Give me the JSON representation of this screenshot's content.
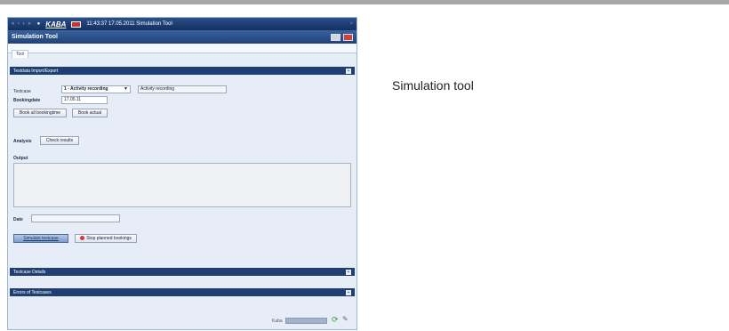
{
  "caption": "Simulation tool",
  "app": {
    "titlebar": {
      "nav": "« ‹ › »",
      "dot": "●",
      "logo": "KABA",
      "info": "11:43:37  17.05.2011  Simulation Tool",
      "close": "×"
    },
    "header_title": "Simulation Tool",
    "tab": "Tool",
    "panels": {
      "testdata": "Testdata Import/Export",
      "details": "Testcase Details",
      "errors": "Errors of Testcases"
    },
    "form": {
      "testcase_label": "Testcase",
      "testcase_value": "1 - Activity recording",
      "testcase_text": "Activity recording",
      "bookingdate_label": "Bookingdate",
      "bookingdate_value": "17.05.11",
      "book_all_label": "Book all bookingtime",
      "book_actual_label": "Book actual",
      "analysis_label": "Analysis",
      "check_results_label": "Check results",
      "output_label": "Output",
      "date_label": "Date",
      "date_value": "",
      "simulate_label": "Simulate testcase",
      "stop_label": "Stop planned bookings"
    },
    "status": {
      "label": "Kaba",
      "progress": 1.0
    }
  }
}
